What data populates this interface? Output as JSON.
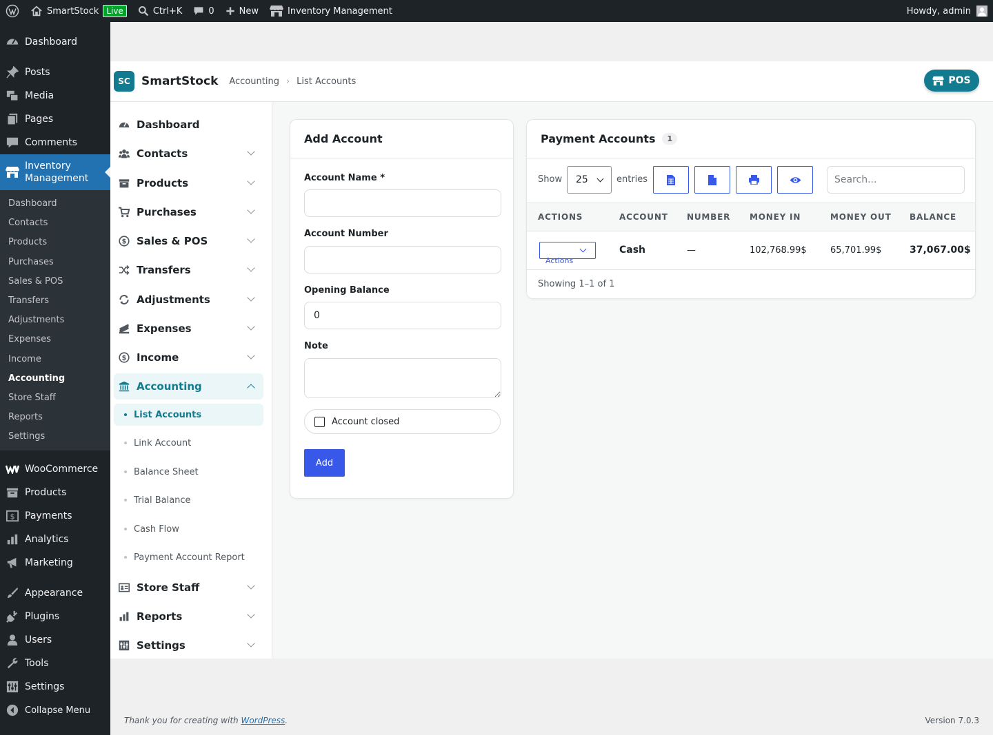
{
  "adminbar": {
    "site_name": "SmartStock",
    "live_badge": "Live",
    "search_shortcut": "Ctrl+K",
    "comments_count": "0",
    "new_label": "New",
    "plugin_link": "Inventory Management",
    "howdy": "Howdy, admin"
  },
  "wpmenu": {
    "dashboard": "Dashboard",
    "posts": "Posts",
    "media": "Media",
    "pages": "Pages",
    "comments": "Comments",
    "inventory": "Inventory Management",
    "submenu": [
      "Dashboard",
      "Contacts",
      "Products",
      "Purchases",
      "Sales & POS",
      "Transfers",
      "Adjustments",
      "Expenses",
      "Income",
      "Accounting",
      "Store Staff",
      "Reports",
      "Settings"
    ],
    "woocommerce": "WooCommerce",
    "products": "Products",
    "payments": "Payments",
    "analytics": "Analytics",
    "marketing": "Marketing",
    "appearance": "Appearance",
    "plugins": "Plugins",
    "users": "Users",
    "tools": "Tools",
    "settings": "Settings",
    "collapse": "Collapse Menu"
  },
  "header": {
    "logo": "SC",
    "brand": "SmartStock",
    "crumb1": "Accounting",
    "crumb_sep": "›",
    "crumb2": "List Accounts",
    "pos": "POS"
  },
  "nav": {
    "items": [
      "Dashboard",
      "Contacts",
      "Products",
      "Purchases",
      "Sales & POS",
      "Transfers",
      "Adjustments",
      "Expenses",
      "Income",
      "Accounting",
      "Store Staff",
      "Reports",
      "Settings"
    ],
    "accounting_sub": [
      "List Accounts",
      "Link Account",
      "Balance Sheet",
      "Trial Balance",
      "Cash Flow",
      "Payment Account Report"
    ]
  },
  "form": {
    "title": "Add Account",
    "name_label": "Account Name *",
    "number_label": "Account Number",
    "opening_label": "Opening Balance",
    "opening_value": "0",
    "note_label": "Note",
    "closed_label": "Account closed",
    "submit": "Add"
  },
  "accounts": {
    "title": "Payment Accounts",
    "count": "1",
    "show_label": "Show",
    "page_size": "25",
    "entries_label": "entries",
    "search_placeholder": "Search...",
    "columns": [
      "ACTIONS",
      "ACCOUNT",
      "NUMBER",
      "MONEY IN",
      "MONEY OUT",
      "BALANCE"
    ],
    "rows": [
      {
        "actions": "Actions",
        "account": "Cash",
        "number": "—",
        "money_in": "102,768.99$",
        "money_out": "65,701.99$",
        "balance": "37,067.00$"
      }
    ],
    "showing": "Showing 1–1 of 1"
  },
  "footer": {
    "thanks_prefix": "Thank you for creating with ",
    "wp_link": "WordPress",
    "thanks_suffix": ".",
    "version": "Version 7.0.3"
  }
}
